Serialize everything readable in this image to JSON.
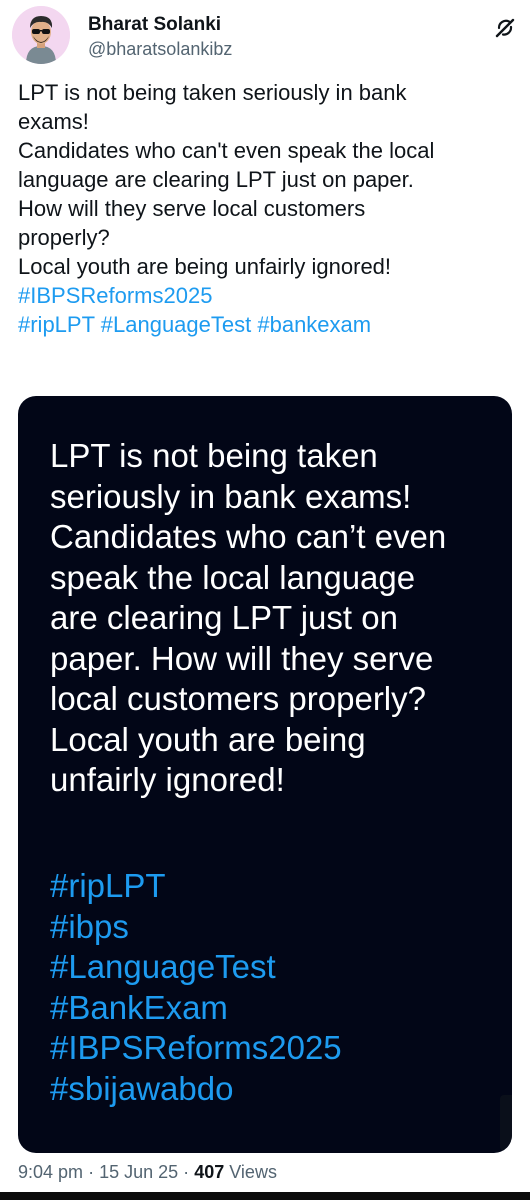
{
  "author": {
    "name": "Bharat Solanki",
    "handle": "@bharatsolankibz",
    "avatar_icon": "cartoon-avatar-icon",
    "avatar_bg": "#f3d7f0"
  },
  "header": {
    "grok_icon": "grok-icon"
  },
  "tweet": {
    "lines": [
      "LPT is not being taken seriously in bank",
      "exams!",
      "Candidates who can't even speak the local",
      "language are clearing LPT just on paper.",
      "How will they serve local customers",
      "properly?",
      "Local youth are being unfairly ignored!"
    ],
    "hashtag_line1": "#IBPSReforms2025",
    "hashtag_line2": [
      "#ripLPT",
      "#LanguageTest",
      "#bankexam"
    ]
  },
  "media": {
    "lines": [
      "LPT is not being taken",
      "seriously in bank exams!",
      "Candidates who can’t even",
      "speak the local language",
      "are clearing LPT just on",
      "paper. How will they serve",
      "local customers properly?",
      "Local youth are being",
      "unfairly ignored!"
    ],
    "hashtags": [
      "#ripLPT",
      "#ibps",
      "#LanguageTest",
      "#BankExam",
      "#IBPSReforms2025",
      "#sbijawabdo"
    ],
    "bg_color": "#020617",
    "tag_color": "#1d9bf0"
  },
  "meta": {
    "time": "9:04 pm",
    "date": "15 Jun 25",
    "views_count": "407",
    "views_label": "Views",
    "separator": "·"
  },
  "colors": {
    "link": "#1d9bf0",
    "text": "#0f1419",
    "secondary": "#536471"
  }
}
